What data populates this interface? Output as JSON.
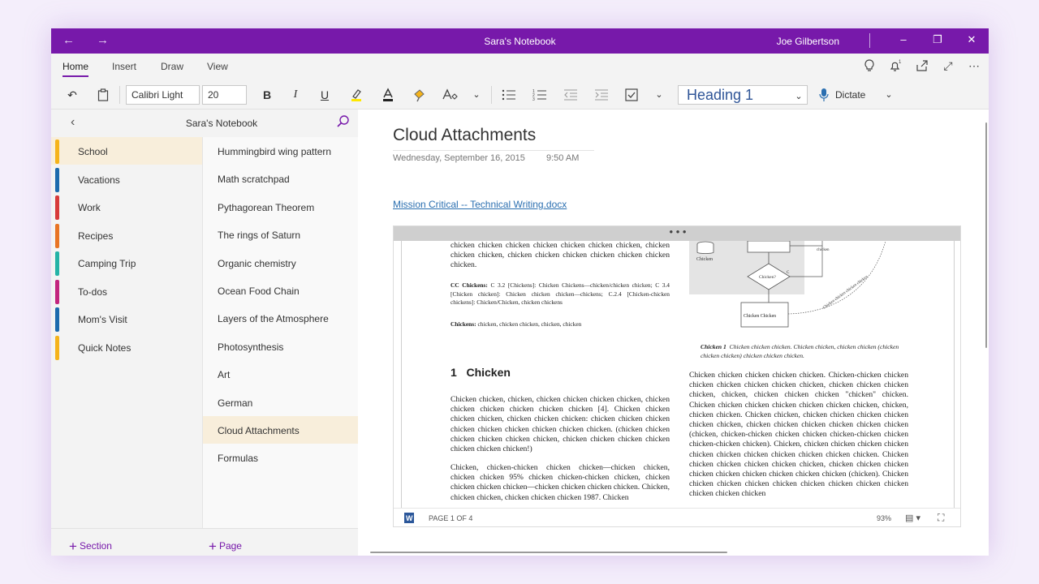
{
  "window": {
    "title": "Sara's Notebook",
    "user": "Joe Gilbertson",
    "accent": "#7719aa"
  },
  "menu": {
    "tabs": [
      "Home",
      "Insert",
      "Draw",
      "View"
    ],
    "active": "Home"
  },
  "ribbon": {
    "font_name": "Calibri Light",
    "font_size": "20",
    "bold": "B",
    "italic": "I",
    "underline": "U",
    "style": "Heading 1",
    "dictate": "Dictate"
  },
  "notebook": {
    "name": "Sara's Notebook",
    "sections": [
      {
        "label": "School",
        "color": "#f5b31a"
      },
      {
        "label": "Vacations",
        "color": "#1c6aad"
      },
      {
        "label": "Work",
        "color": "#d73a3a"
      },
      {
        "label": "Recipes",
        "color": "#e87424"
      },
      {
        "label": "Camping Trip",
        "color": "#25b3a6"
      },
      {
        "label": "To-dos",
        "color": "#c2257e"
      },
      {
        "label": "Mom's Visit",
        "color": "#1c6aad"
      },
      {
        "label": "Quick Notes",
        "color": "#f5b31a"
      }
    ],
    "active_section": 0,
    "pages": [
      "Hummingbird wing pattern",
      "Math scratchpad",
      "Pythagorean Theorem",
      "The rings of Saturn",
      "Organic chemistry",
      "Ocean Food Chain",
      "Layers of the Atmosphere",
      "Photosynthesis",
      "Art",
      "German",
      "Cloud Attachments",
      "Formulas"
    ],
    "active_page": 10,
    "add_section": "Section",
    "add_page": "Page"
  },
  "page": {
    "title": "Cloud Attachments",
    "date": "Wednesday, September 16, 2015",
    "time": "9:50 AM",
    "attachment": "Mission Critical -- Technical Writing.docx"
  },
  "doc": {
    "menu_dots": "• • •",
    "p1": "chicken chicken chicken chicken chicken chicken chicken, chicken chicken chicken, chicken chicken chicken chicken chicken chicken chicken.",
    "cc_label": "CC Chickens:",
    "cc_text": "C 3.2 [Chickens]: Chicken Chickens—chicken/chicken chicken; C 3.4 [Chicken chicken]: Chicken chicken chicken—chickens; C.2.4 [Chicken-chicken chickens]: Chicken/Chicken, chicken chickens",
    "kw_label": "Chickens:",
    "kw_text": "chicken, chicken chicken, chicken, chicken",
    "heading_num": "1",
    "heading": "Chicken",
    "p2": "Chicken chicken, chicken, chicken chicken chicken chicken, chicken chicken chicken chicken chicken chicken [4]. Chicken chicken chicken chicken, chicken chicken chicken: chicken chicken chicken chicken chicken chicken chicken chicken chicken. (chicken chicken chicken chicken chicken chicken, chicken chicken chicken chicken chicken chicken chicken!)",
    "p3": "Chicken, chicken-chicken chicken chicken—chicken chicken, chicken chicken 95% chicken chicken-chicken chicken, chicken chicken chicken chicken—chicken chicken chicken chicken. Chicken, chicken chicken, chicken chicken chicken 1987. Chicken",
    "caption_label": "Chicken 1",
    "caption": "Chicken chicken chicken. Chicken chicken, chicken chicken (chicken chicken chicken) chicken chicken chicken.",
    "p4": "Chicken chicken chicken chicken chicken. Chicken-chicken chicken chicken chicken chicken chicken chicken, chicken chicken chicken chicken, chicken, chicken chicken chicken \"chicken\" chicken. Chicken chicken chicken chicken chicken chicken chicken, chicken, chicken chicken. Chicken chicken, chicken chicken chicken chicken chicken chicken, chicken chicken chicken chicken chicken chicken (chicken, chicken-chicken chicken chicken chicken-chicken chicken chicken-chicken chicken). Chicken, chicken chicken chicken chicken chicken chicken chicken chicken chicken chicken chicken. Chicken chicken chicken chicken chicken chicken, chicken chicken chicken chicken chicken chicken chicken chicken chicken (chicken). Chicken chicken chicken chicken chicken chicken chicken chicken chicken chicken chicken chicken",
    "fig_label_chicken": "Chicken",
    "fig_label_decision": "Chicken?",
    "fig_label_box": "Chicken Chicken",
    "fig_label_curve": "Chicken chicken chicken chicken",
    "fig_label_small": "chicken",
    "fig_label_c": "C",
    "page_indicator": "PAGE 1 OF 4",
    "zoom": "93%"
  }
}
